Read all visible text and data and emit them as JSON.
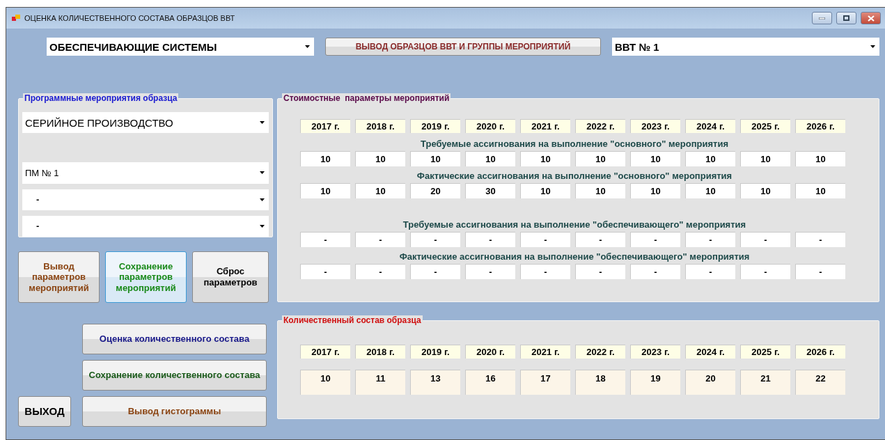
{
  "window": {
    "title": "ОЦЕНКА КОЛИЧЕСТВЕННОГО СОСТАВА ОБРАЗЦОВ ВВТ"
  },
  "top": {
    "category_combo": "ОБЕСПЕЧИВАЮЩИЕ СИСТЕМЫ",
    "show_button": "ВЫВОД ОБРАЗЦОВ ВВТ И ГРУППЫ МЕРОПРИЯТИЙ",
    "sample_combo": "ВВТ № 1"
  },
  "program_events": {
    "title": "Программные мероприятия образца",
    "combos": [
      {
        "value": "СЕРИЙНОЕ ПРОИЗВОДСТВО",
        "kind": "main"
      },
      {
        "value": "ПМ № 1",
        "kind": "sub"
      },
      {
        "value": "-",
        "kind": "dash"
      },
      {
        "value": "-",
        "kind": "dash"
      }
    ]
  },
  "event_buttons": [
    {
      "label": "Вывод параметров мероприятий",
      "color": "#8b4513",
      "selected": false
    },
    {
      "label": "Сохранение параметров мероприятий",
      "color": "#1a8a1a",
      "selected": true
    },
    {
      "label": "Сброс параметров",
      "color": "#000000",
      "selected": false
    }
  ],
  "cost_params": {
    "title": "Стоимостные  параметры мероприятий",
    "years": [
      "2017 г.",
      "2018 г.",
      "2019 г.",
      "2020 г.",
      "2021 г.",
      "2022 г.",
      "2023 г.",
      "2024 г.",
      "2025 г.",
      "2026 г."
    ],
    "rows": [
      {
        "caption": "Требуемые ассигнования на выполнение \"основного\" мероприятия",
        "values": [
          "10",
          "10",
          "10",
          "10",
          "10",
          "10",
          "10",
          "10",
          "10",
          "10"
        ]
      },
      {
        "caption": "Фактические ассигнования на выполнение \"основного\" мероприятия",
        "values": [
          "10",
          "10",
          "20",
          "30",
          "10",
          "10",
          "10",
          "10",
          "10",
          "10"
        ]
      },
      {
        "caption": "Требуемые ассигнования на выполнение \"обеспечивающего\" мероприятия",
        "values": [
          "-",
          "-",
          "-",
          "-",
          "-",
          "-",
          "-",
          "-",
          "-",
          "-"
        ]
      },
      {
        "caption": "Фактические ассигнования на выполнение \"обеспечивающего\" мероприятия",
        "values": [
          "-",
          "-",
          "-",
          "-",
          "-",
          "-",
          "-",
          "-",
          "-",
          "-"
        ]
      }
    ]
  },
  "quantity_buttons": [
    {
      "label": "Оценка количественного состава",
      "color": "#1a1a8a"
    },
    {
      "label": "Сохранение количественного состава",
      "color": "#1a5a1a"
    },
    {
      "label": "Вывод гистограммы",
      "color": "#8b4513"
    }
  ],
  "exit_button": "ВЫХОД",
  "quantity": {
    "title": "Количественный состав образца",
    "years": [
      "2017 г.",
      "2018 г.",
      "2019 г.",
      "2020 г.",
      "2021 г.",
      "2022 г.",
      "2023 г.",
      "2024 г.",
      "2025 г.",
      "2026 г."
    ],
    "values": [
      "10",
      "11",
      "13",
      "16",
      "17",
      "18",
      "19",
      "20",
      "21",
      "22"
    ]
  }
}
